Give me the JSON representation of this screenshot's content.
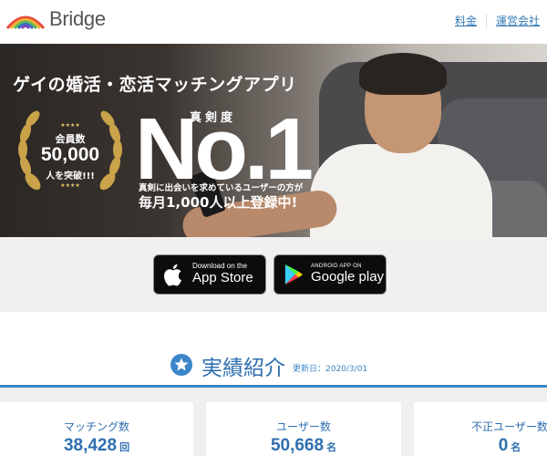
{
  "header": {
    "brand": "Bridge",
    "nav": [
      {
        "label": "料金"
      },
      {
        "label": "運営会社"
      }
    ]
  },
  "hero": {
    "title": "ゲイの婚活・恋活マッチングアプリ",
    "badge": {
      "line1": "会員数",
      "line2": "50,000",
      "line3": "人を突破!!!",
      "stars": "★★★★"
    },
    "rank_label": "真剣度",
    "rank": "No.1",
    "sub1": "真剣に出会いを求めているユーザーの方が",
    "sub2": "毎月1,000人以上登録中!"
  },
  "app_badges": {
    "apple": {
      "small": "Download on the",
      "big": "App Store"
    },
    "google": {
      "small": "ANDROID APP ON",
      "big": "Google play"
    }
  },
  "results": {
    "title": "実績紹介",
    "updated": "更新日：2020/3/01",
    "stats": [
      {
        "label": "マッチング数",
        "value": "38,428",
        "unit": "回"
      },
      {
        "label": "ユーザー数",
        "value": "50,668",
        "unit": "名"
      },
      {
        "label": "不正ユーザー数",
        "value": "0",
        "unit": "名"
      }
    ]
  },
  "colors": {
    "accent": "#3a86c8",
    "text_blue": "#2f6fb0",
    "gold": "#c9a24a"
  }
}
